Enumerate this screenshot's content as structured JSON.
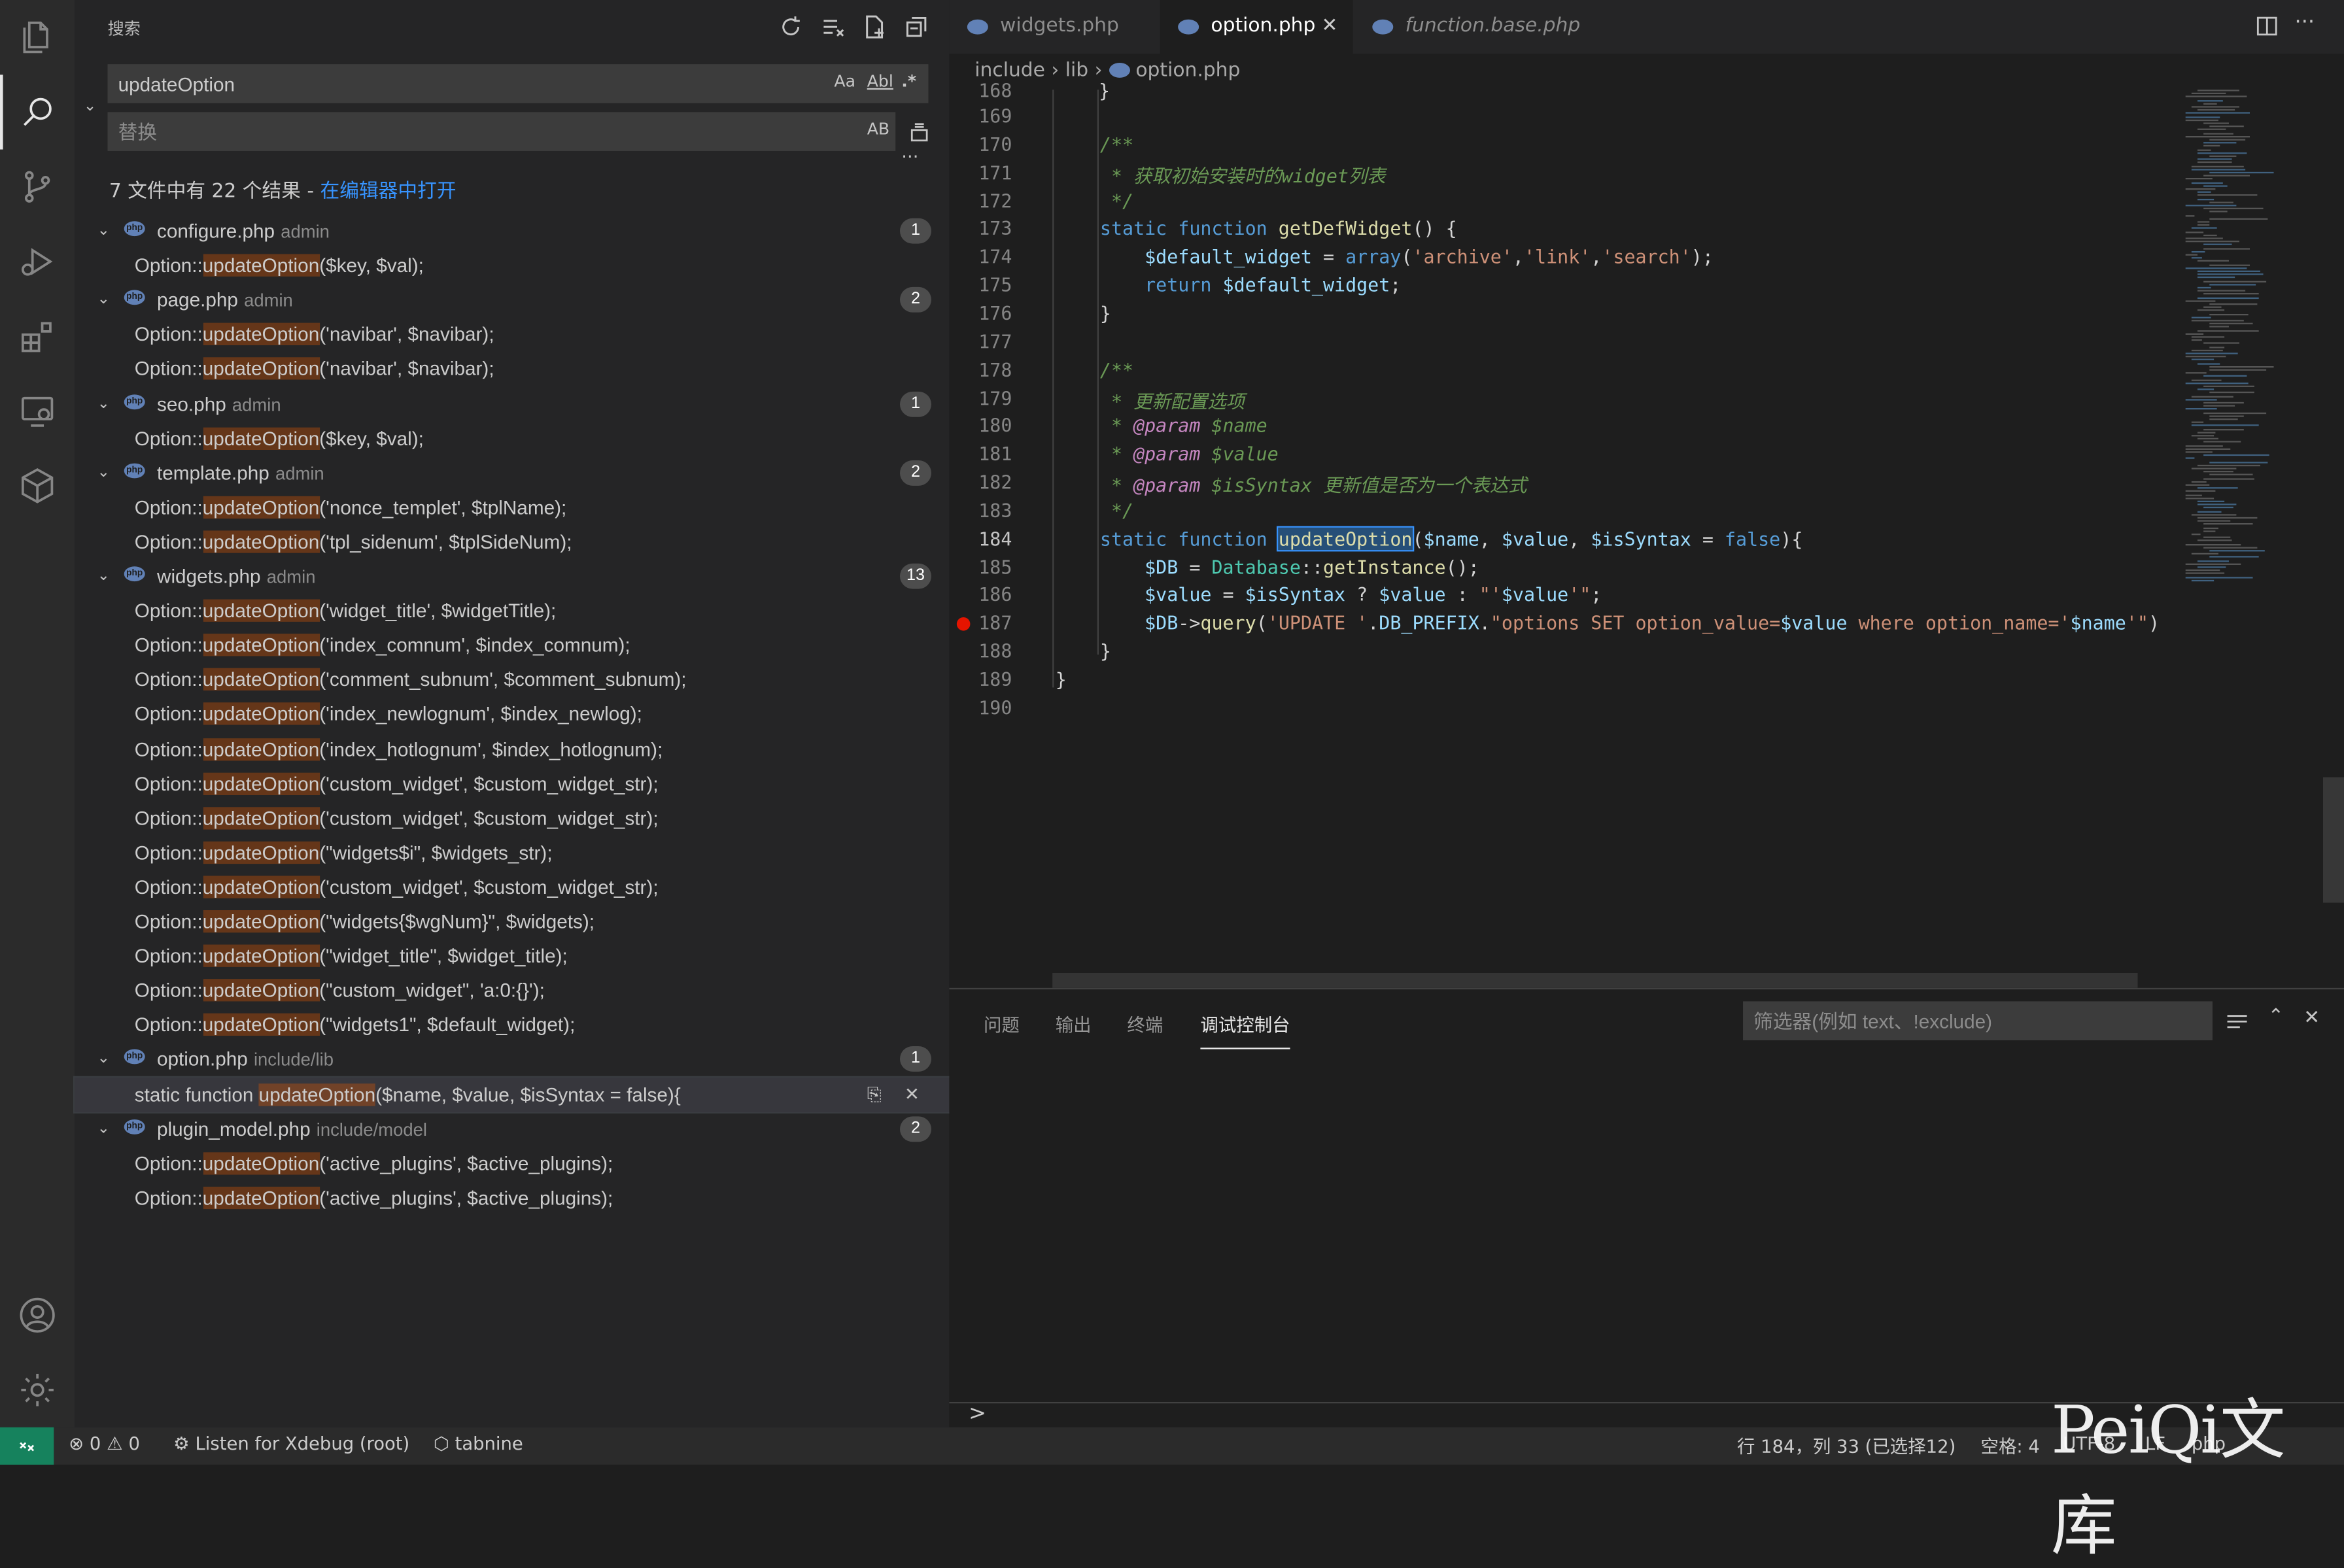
{
  "sidebar": {
    "title": "搜索",
    "search_value": "updateOption",
    "replace_placeholder": "替换",
    "opt_case": "Aa",
    "opt_word": "Abl",
    "opt_regex": ".*",
    "opt_preserve": "AB",
    "more": "···",
    "summary": "7 文件中有 22 个结果 - ",
    "summary_link": "在编辑器中打开",
    "files": [
      {
        "name": "configure.php",
        "dir": "admin",
        "count": "1",
        "matches": [
          {
            "pre": "Option::",
            "hit": "updateOption",
            "post": "($key, $val);"
          }
        ]
      },
      {
        "name": "page.php",
        "dir": "admin",
        "count": "2",
        "matches": [
          {
            "pre": "Option::",
            "hit": "updateOption",
            "post": "('navibar', $navibar);"
          },
          {
            "pre": "Option::",
            "hit": "updateOption",
            "post": "('navibar', $navibar);"
          }
        ]
      },
      {
        "name": "seo.php",
        "dir": "admin",
        "count": "1",
        "matches": [
          {
            "pre": "Option::",
            "hit": "updateOption",
            "post": "($key, $val);"
          }
        ]
      },
      {
        "name": "template.php",
        "dir": "admin",
        "count": "2",
        "matches": [
          {
            "pre": "Option::",
            "hit": "updateOption",
            "post": "('nonce_templet', $tplName);"
          },
          {
            "pre": "Option::",
            "hit": "updateOption",
            "post": "('tpl_sidenum', $tplSideNum);"
          }
        ]
      },
      {
        "name": "widgets.php",
        "dir": "admin",
        "count": "13",
        "matches": [
          {
            "pre": "Option::",
            "hit": "updateOption",
            "post": "('widget_title', $widgetTitle);"
          },
          {
            "pre": "Option::",
            "hit": "updateOption",
            "post": "('index_comnum', $index_comnum);"
          },
          {
            "pre": "Option::",
            "hit": "updateOption",
            "post": "('comment_subnum', $comment_subnum);"
          },
          {
            "pre": "Option::",
            "hit": "updateOption",
            "post": "('index_newlognum', $index_newlog);"
          },
          {
            "pre": "Option::",
            "hit": "updateOption",
            "post": "('index_hotlognum', $index_hotlognum);"
          },
          {
            "pre": "Option::",
            "hit": "updateOption",
            "post": "('custom_widget', $custom_widget_str);"
          },
          {
            "pre": "Option::",
            "hit": "updateOption",
            "post": "('custom_widget', $custom_widget_str);"
          },
          {
            "pre": "Option::",
            "hit": "updateOption",
            "post": "(\"widgets$i\", $widgets_str);"
          },
          {
            "pre": "Option::",
            "hit": "updateOption",
            "post": "('custom_widget', $custom_widget_str);"
          },
          {
            "pre": "Option::",
            "hit": "updateOption",
            "post": "(\"widgets{$wgNum}\", $widgets);"
          },
          {
            "pre": "Option::",
            "hit": "updateOption",
            "post": "(\"widget_title\", $widget_title);"
          },
          {
            "pre": "Option::",
            "hit": "updateOption",
            "post": "(\"custom_widget\", 'a:0:{}');"
          },
          {
            "pre": "Option::",
            "hit": "updateOption",
            "post": "(\"widgets1\", $default_widget);"
          }
        ]
      },
      {
        "name": "option.php",
        "dir": "include/lib",
        "count": "1",
        "matches": [
          {
            "pre": "static function ",
            "hit": "updateOption",
            "post": "($name, $value, $isSyntax = false){",
            "selected": true
          }
        ]
      },
      {
        "name": "plugin_model.php",
        "dir": "include/model",
        "count": "2",
        "matches": [
          {
            "pre": "Option::",
            "hit": "updateOption",
            "post": "('active_plugins', $active_plugins);"
          },
          {
            "pre": "Option::",
            "hit": "updateOption",
            "post": "('active_plugins', $active_plugins);"
          }
        ]
      }
    ]
  },
  "tabs": [
    {
      "label": "widgets.php",
      "active": false
    },
    {
      "label": "option.php",
      "active": true
    },
    {
      "label": "function.base.php",
      "active": false
    }
  ],
  "breadcrumb": {
    "p1": "include",
    "p2": "lib",
    "p3": "option.php"
  },
  "code": {
    "first_line_partial": "168",
    "lines": [
      {
        "n": "169",
        "t": ""
      },
      {
        "n": "170",
        "t": "    /**"
      },
      {
        "n": "171",
        "t": "     * 获取初始安装时的widget列表"
      },
      {
        "n": "172",
        "t": "     */"
      },
      {
        "n": "173",
        "t": "    static function getDefWidget() {"
      },
      {
        "n": "174",
        "t": "        $default_widget = array('archive','link','search');"
      },
      {
        "n": "175",
        "t": "        return $default_widget;"
      },
      {
        "n": "176",
        "t": "    }"
      },
      {
        "n": "177",
        "t": ""
      },
      {
        "n": "178",
        "t": "    /**"
      },
      {
        "n": "179",
        "t": "     * 更新配置选项"
      },
      {
        "n": "180",
        "t": "     * @param $name"
      },
      {
        "n": "181",
        "t": "     * @param $value"
      },
      {
        "n": "182",
        "t": "     * @param $isSyntax 更新值是否为一个表达式"
      },
      {
        "n": "183",
        "t": "     */"
      },
      {
        "n": "184",
        "t": "    static function updateOption($name, $value, $isSyntax = false){"
      },
      {
        "n": "185",
        "t": "        $DB = Database::getInstance();"
      },
      {
        "n": "186",
        "t": "        $value = $isSyntax ? $value : \"'$value'\";"
      },
      {
        "n": "187",
        "t": "        $DB->query('UPDATE '.DB_PREFIX.\"options SET option_value=$value where option_name='$name'\")"
      },
      {
        "n": "188",
        "t": "    }"
      },
      {
        "n": "189",
        "t": "}"
      },
      {
        "n": "190",
        "t": ""
      }
    ]
  },
  "panel": {
    "tabs": [
      "问题",
      "输出",
      "终端",
      "调试控制台"
    ],
    "active_tab": "调试控制台",
    "filter_placeholder": "筛选器(例如 text、!exclude)",
    "prompt": ">"
  },
  "status": {
    "errors": "0",
    "warnings": "0",
    "xdebug": "Listen for Xdebug (root)",
    "tabnine": "tabnine",
    "position": "行 184，列 33 (已选择12)",
    "spaces": "空格: 4",
    "encoding": "UTF-8",
    "eol": "LF",
    "language": "php"
  },
  "watermark": "PeiQi文库",
  "colors": {
    "accent": "#3794ff",
    "remote": "#16825d",
    "match_highlight": "#ea5c00",
    "breakpoint": "#e51400"
  }
}
